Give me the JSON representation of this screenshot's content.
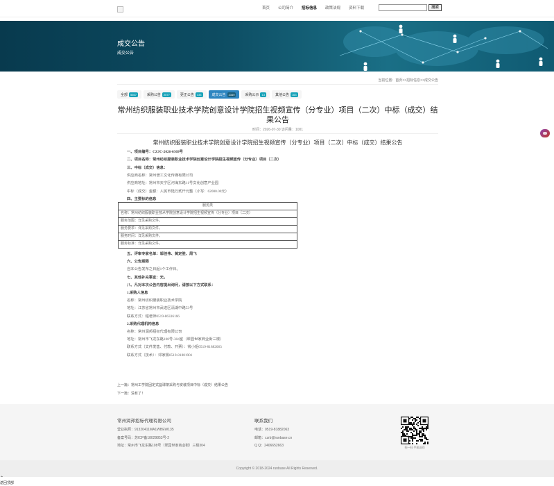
{
  "nav": {
    "items": [
      "首页",
      "公司简介",
      "招标信息",
      "政策法规",
      "资料下载"
    ],
    "active_index": 2
  },
  "search": {
    "placeholder": "",
    "button_label": "搜索"
  },
  "banner": {
    "title": "成交公告",
    "subtitle": "成交公告"
  },
  "breadcrumb": "当前位置：首页>>招标信息>>成交公告",
  "tabs": [
    {
      "label": "全部",
      "count": "5667"
    },
    {
      "label": "采购公告",
      "count": "2577"
    },
    {
      "label": "更正公告",
      "count": "333"
    },
    {
      "label": "成交公告",
      "count": "2349"
    },
    {
      "label": "采购公示",
      "count": "13"
    },
    {
      "label": "其他公告",
      "count": "163"
    }
  ],
  "active_tab_index": 3,
  "article": {
    "title": "常州纺织服装职业技术学院创意设计学院招生视频宣传（分专业）项目（二次）中标（成交）结果公告",
    "meta": "时间：2026-07-30   访问量：1001",
    "doc_title": "常州纺织服装职业技术学院创意设计学院招生视频宣传（分专业）项目（二次）中标（成交）结果公告",
    "lines_a": [
      "一、项目编号：CZJC-2026-0369号",
      "二、项目名称：常州纺织服装职业技术学院创意设计学院招生视频宣传（分专业）项目（二次）",
      "三、中标（成交）信息：",
      "供应商名称：常州谱工文化传媒有限公司",
      "供应商地址：常州市天宁区河海东路11号文化创意产业园",
      "中标（成交）金额：人民币陆万贰仟元整（小写：62000.00元）",
      "四、主要标的信息"
    ],
    "service_table": {
      "header": "服务类",
      "rows": [
        "名称：常州纺织服装职业技术学院创意设计学院招生视频宣传（分专业）项目（二次）",
        "服务范围：详见采购文件。",
        "服务要求：详见采购文件。",
        "服务时间：详见采购文件。",
        "服务标准：详见采购文件。"
      ]
    },
    "lines_b": [
      "五、评审专家名单：邹佳伟、黄定胜、周飞",
      "六、公告期限",
      "自本公告发布之日起1个工作日。",
      "七、其他补充事宜：无。",
      "八、凡对本次公告内容提出询问，请按以下方式联系：",
      "1.采购人信息",
      "名称：常州纺织服装职业技术学院",
      "地址：江苏省常州市武进区滆湖中路53号",
      "联系方式：程老师0519-86336166",
      "2.采购代理机构信息",
      "名称：常州润邦招标代理有限公司",
      "地址：常州市飞龙东路108号-304室（翠园世家商业街三楼）",
      "联系方式（文件发售、付款、开票）：钱小姐0519-81882063",
      "联系方式（技术）：邓家佩0519-81881901"
    ],
    "bold_lines": [
      0,
      1,
      2,
      6
    ]
  },
  "prev_label": "上一篇：常州工学院固定式篮球架采购与安装项目中标（成交）结果公告",
  "next_label": "下一篇：没有了！",
  "footer": {
    "company": "常州润邦招标代理有限公司",
    "company_lines": [
      "营业执照：91320411MA1WBEW135",
      "备案号码：苏ICP备18029853号-2",
      "地址：常州市飞龙东路108号（翠园世家商业街）三楼304"
    ],
    "contact_title": "联系我们",
    "contact_lines": [
      "电话：0519-81882063",
      "邮箱：czrb@runbase.cn",
      "Q  Q：2406652663"
    ],
    "qr_caption": "扫一扫 手机访问",
    "copyright": "Copyright © 2018-2024 runbase All Rights Reserved."
  },
  "back_to_top": "返回顶部"
}
